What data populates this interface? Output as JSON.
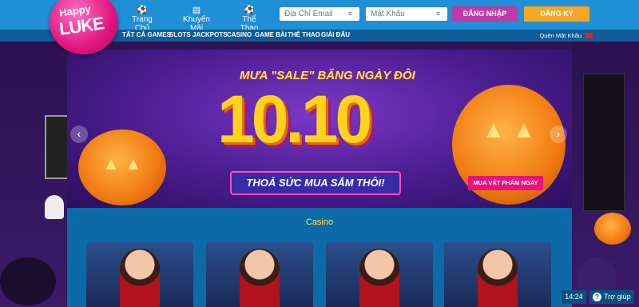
{
  "brand": {
    "line1": "Happy",
    "line2": "LUKE"
  },
  "nav": [
    {
      "label": "Trang Chủ",
      "icon": "soccer-ball-icon",
      "glyph": "⚽"
    },
    {
      "label": "Khuyến Mãi",
      "icon": "promo-icon",
      "glyph": "▤"
    },
    {
      "label": "Thể Thao",
      "icon": "soccer-ball-icon",
      "glyph": "⚽"
    }
  ],
  "login": {
    "email_placeholder": "Địa Chỉ Email",
    "password_placeholder": "Mật Khẩu",
    "login_label": "ĐĂNG NHẬP",
    "register_label": "ĐĂNG KÝ",
    "forgot_label": "Quên Mật Khẩu"
  },
  "subnav": [
    "TẤT CẢ GAMES",
    "SLOTS",
    "JACKPOTS",
    "CASINO",
    "GAME BÀI",
    "THỂ THAO",
    "GIẢI ĐẤU"
  ],
  "banner": {
    "headline": "MƯA \"SALE\" BĂNG NGÀY ĐÔI",
    "big_text": "10.10",
    "tagline": "THOẢ SỨC MUA SẮM THÔI!",
    "cta": "MUA VẬT PHẨM NGAY",
    "prev_glyph": "‹",
    "next_glyph": "›",
    "slide_count": 6,
    "active_slide": 3
  },
  "section": {
    "title": "Casino"
  },
  "cards": [
    {},
    {},
    {},
    {}
  ],
  "footer": {
    "time": "14:24",
    "help_label": "Trợ giúp"
  },
  "colors": {
    "accent_blue": "#1f8fd6",
    "login_btn": "#c03aa8",
    "register_btn": "#f5a623",
    "section_bg": "#0d6aa8"
  }
}
